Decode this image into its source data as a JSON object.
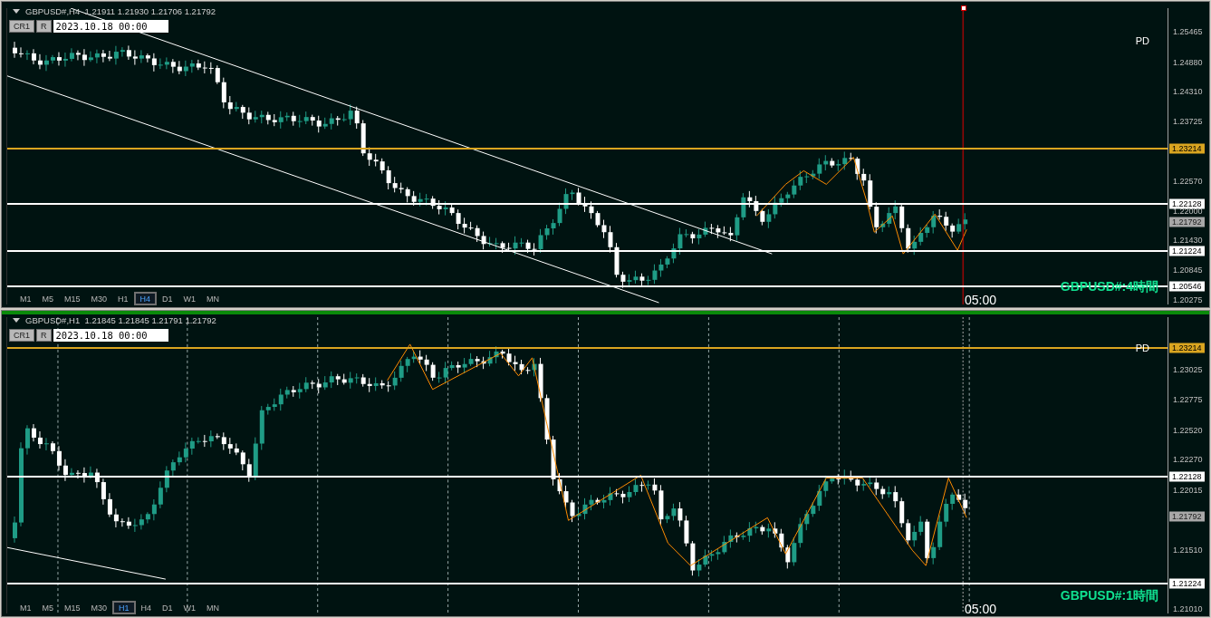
{
  "panes": [
    {
      "active": false,
      "header": "GBPUSD#,H4  1.21911 1.21930 1.21706 1.21792",
      "cr_button": "CR1",
      "r_button": "R",
      "date": "2023.10.18 00:00",
      "pd_label": "PD",
      "title": "GBPUSD#:4時間",
      "time_label": "05:00",
      "axis_labels": [
        "1.25465",
        "1.24880",
        "1.24310",
        "1.23725",
        "1.22570",
        "1.22000",
        "1.21430",
        "1.20845",
        "1.20275"
      ],
      "levels": [
        {
          "price": "1.23214",
          "color": "#daa520"
        },
        {
          "price": "1.22128",
          "color": "#ffffff"
        },
        {
          "price": "1.21224",
          "color": "#ffffff"
        },
        {
          "price": "1.20546",
          "color": "#ffffff"
        }
      ],
      "current_price": "1.21792",
      "timeframes": [
        {
          "label": "M1",
          "selected": false
        },
        {
          "label": "M5",
          "selected": false
        },
        {
          "label": "M15",
          "selected": false
        },
        {
          "label": "M30",
          "selected": false
        },
        {
          "label": "H1",
          "selected": false
        },
        {
          "label": "H4",
          "selected": true
        },
        {
          "label": "D1",
          "selected": false
        },
        {
          "label": "W1",
          "selected": false
        },
        {
          "label": "MN",
          "selected": false
        }
      ]
    },
    {
      "active": true,
      "header": "GBPUSD#,H1  1.21845 1.21845 1.21791 1.21792",
      "cr_button": "CR1",
      "r_button": "R",
      "date": "2023.10.18 00:00",
      "pd_label": "PD",
      "title": "GBPUSD#:1時間",
      "time_label": "05:00",
      "axis_labels": [
        "1.23025",
        "1.22775",
        "1.22520",
        "1.22270",
        "1.22015",
        "1.21510",
        "1.21010"
      ],
      "levels": [
        {
          "price": "1.23214",
          "color": "#daa520"
        },
        {
          "price": "1.22128",
          "color": "#ffffff"
        },
        {
          "price": "1.21224",
          "color": "#ffffff"
        }
      ],
      "current_price": "1.21792",
      "timeframes": [
        {
          "label": "M1",
          "selected": false
        },
        {
          "label": "M5",
          "selected": false
        },
        {
          "label": "M15",
          "selected": false
        },
        {
          "label": "M30",
          "selected": false
        },
        {
          "label": "H1",
          "selected": true
        },
        {
          "label": "H4",
          "selected": false
        },
        {
          "label": "D1",
          "selected": false
        },
        {
          "label": "W1",
          "selected": false
        },
        {
          "label": "MN",
          "selected": false
        }
      ]
    }
  ]
}
